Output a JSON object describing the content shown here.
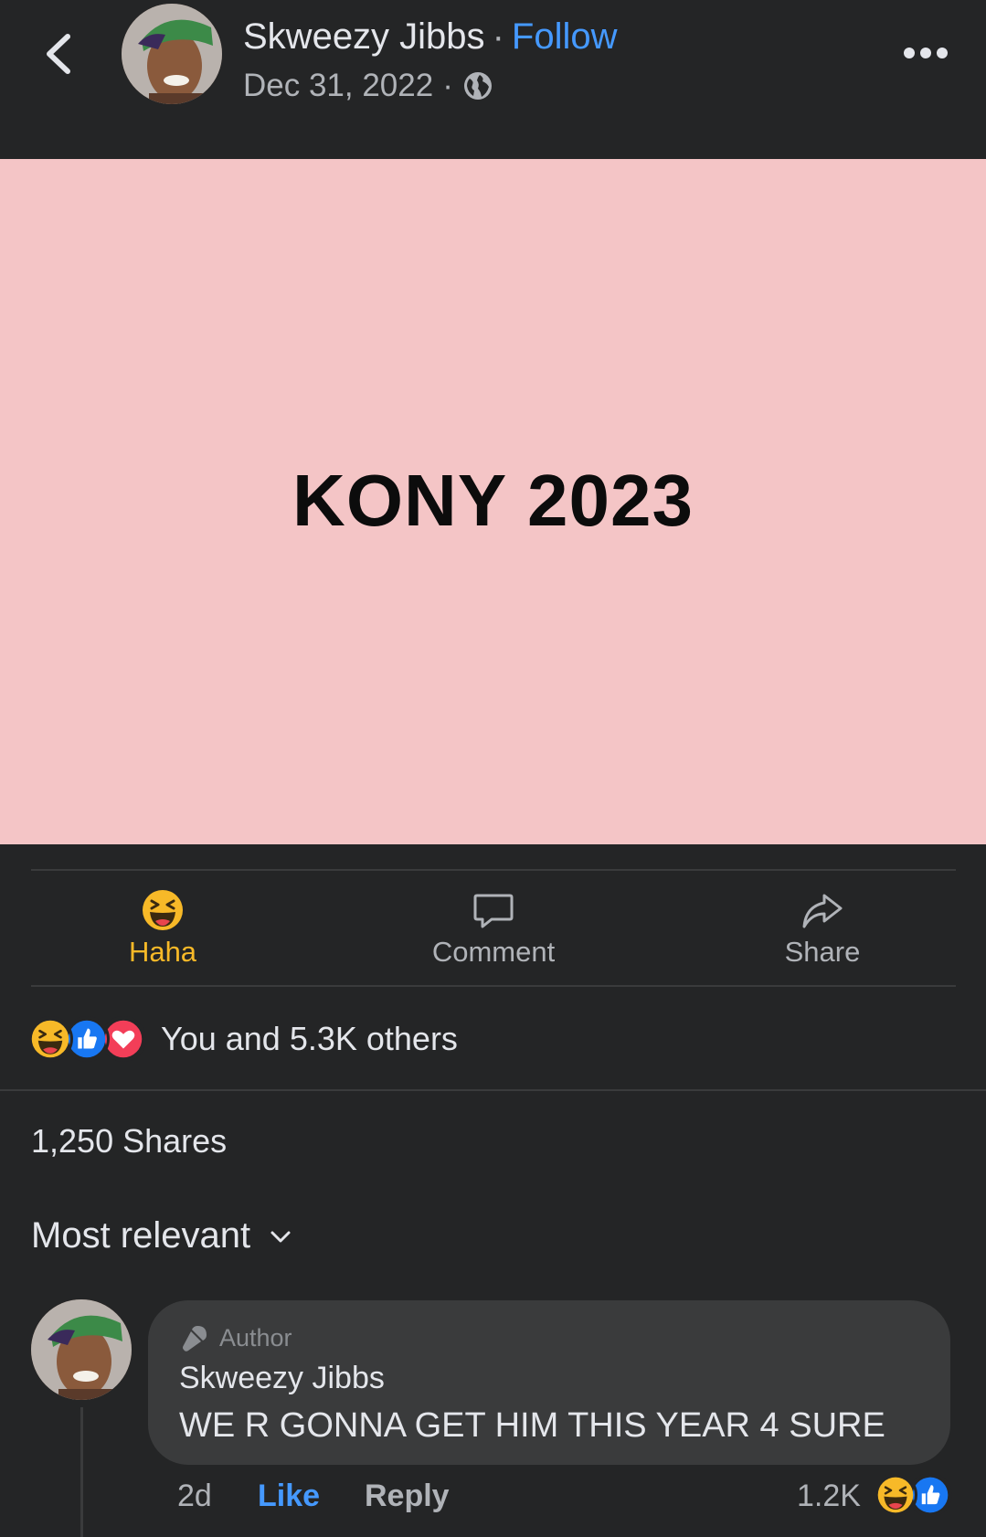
{
  "header": {
    "author_name": "Skweezy Jibbs",
    "separator": "·",
    "follow_label": "Follow",
    "date": "Dec 31, 2022",
    "privacy_icon": "globe-icon",
    "back_icon": "chevron-left-icon",
    "more_icon": "more-dots-icon"
  },
  "post": {
    "text": "KONY 2023",
    "background_color": "#f4c5c6"
  },
  "actions": [
    {
      "label": "Haha",
      "icon": "haha-reaction-icon",
      "color": "#f7b928"
    },
    {
      "label": "Comment",
      "icon": "comment-icon"
    },
    {
      "label": "Share",
      "icon": "share-icon"
    }
  ],
  "reactions": {
    "icons": [
      "haha-icon",
      "like-icon",
      "love-icon"
    ],
    "summary": "You and 5.3K others"
  },
  "shares_text": "1,250 Shares",
  "sort_label": "Most relevant",
  "comment": {
    "badge": "Author",
    "name": "Skweezy Jibbs",
    "text": "WE R GONNA GET HIM THIS YEAR 4 SURE",
    "time": "2d",
    "like_label": "Like",
    "reply_label": "Reply",
    "reaction_count": "1.2K",
    "reaction_icons": [
      "haha-icon",
      "like-icon"
    ]
  },
  "colors": {
    "background": "#242526",
    "accent_blue": "#4599ff",
    "haha_yellow": "#f7b928",
    "bubble": "#3a3b3c"
  }
}
